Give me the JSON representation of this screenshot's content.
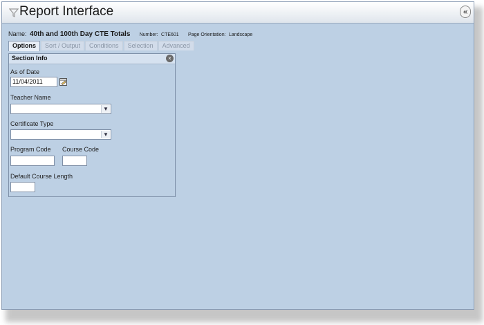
{
  "window": {
    "title": "Report Interface",
    "collapse_icon": "«"
  },
  "report": {
    "name_label": "Name:",
    "name_value": "40th and 100th Day CTE Totals",
    "number_label": "Number:",
    "number_value": "CTE601",
    "orientation_label": "Page Orientation:",
    "orientation_value": "Landscape"
  },
  "tabs": [
    {
      "label": "Options",
      "active": true
    },
    {
      "label": "Sort / Output",
      "active": false
    },
    {
      "label": "Conditions",
      "active": false
    },
    {
      "label": "Selection",
      "active": false
    },
    {
      "label": "Advanced",
      "active": false
    }
  ],
  "section": {
    "title": "Section Info",
    "close_icon": "close-icon",
    "as_of_date_label": "As of Date",
    "as_of_date_value": "11/04/2011",
    "teacher_name_label": "Teacher Name",
    "teacher_name_value": "",
    "certificate_type_label": "Certificate Type",
    "certificate_type_value": "",
    "program_code_label": "Program Code",
    "program_code_value": "",
    "course_code_label": "Course Code",
    "course_code_value": "",
    "default_course_length_label": "Default Course Length",
    "default_course_length_value": ""
  },
  "colors": {
    "background": "#bdd0e4",
    "panel_header": "#d6e2f0",
    "border": "#7e90a8"
  }
}
